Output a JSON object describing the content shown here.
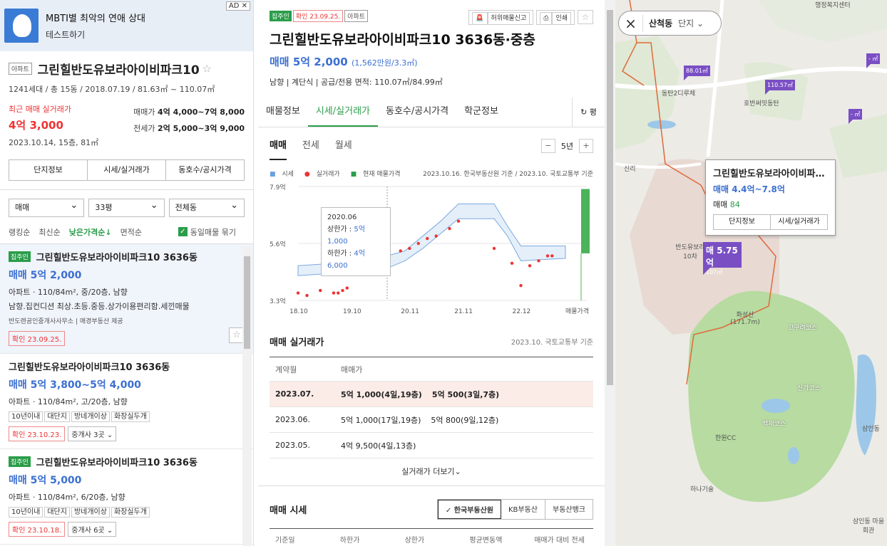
{
  "ad": {
    "title": "MBTI별 최악의 연애 상대",
    "subtitle": "테스트하기",
    "badge": "AD ✕"
  },
  "complex": {
    "type_tag": "아파트",
    "name": "그린힐반도유보라아이비파크10",
    "info": "1241세대 / 총 15동 / 2018.07.19 / 81.63㎡ ~ 110.07㎡",
    "recent_label": "최근 매매 실거래가",
    "recent_price": "4억 3,000",
    "recent_date": "2023.10.14, 15층, 81㎡",
    "sale_label": "매매가",
    "sale_range": "4억 4,000~7억 8,000",
    "jeonse_label": "전세가",
    "jeonse_range": "2억 5,000~3억 9,000",
    "buttons": [
      "단지정보",
      "시세/실거래가",
      "동호수/공시가격"
    ]
  },
  "filters": [
    "매매",
    "33평",
    "전체동"
  ],
  "sort": {
    "options": [
      "랭킹순",
      "최신순",
      "낮은가격순↓",
      "면적순"
    ],
    "active": 2,
    "group_label": "동일매물 묶기"
  },
  "listings": [
    {
      "tag": "집주인",
      "title": "그린힐반도유보라아이비파크10 3636동",
      "price": "매매 5억 2,000",
      "spec": "아파트 · 110/84m², 중/20층, 남향",
      "desc": "남향.집컨디션 최상.초등.중등.상가이용편리함.세낀매물",
      "agent": "반도렌공인중개사사무소 | 매경부동산 제공",
      "confirm": "확인 23.09.25."
    },
    {
      "tag": "",
      "title": "그린힐반도유보라아이비파크10 3636동",
      "price": "매매 5억 3,800~5억 4,000",
      "spec": "아파트 · 110/84m², 고/20층, 남향",
      "tags": [
        "10년이내",
        "대단지",
        "방네개이상",
        "화장실두개"
      ],
      "confirm": "확인 23.10.23.",
      "agents": "중개사 3곳 ⌄"
    },
    {
      "tag": "집주인",
      "title": "그린힐반도유보라아이비파크10 3636동",
      "price": "매매 5억 5,000",
      "spec": "아파트 · 110/84m², 6/20층, 남향",
      "tags": [
        "10년이내",
        "대단지",
        "방네개이상",
        "화장실두개"
      ],
      "confirm": "확인 23.10.18.",
      "agents": "중개사 6곳 ⌄"
    }
  ],
  "detail": {
    "tags": [
      "집주인",
      "확인 23.09.25.",
      "아파트"
    ],
    "tools": [
      "허위매물신고",
      "인쇄"
    ],
    "title": "그린힐반도유보라아이비파크10 3636동·중층",
    "price": "매매 5억 2,000",
    "price_unit": "(1,562만원/3.3㎡)",
    "meta": "남향 | 계단식 | 공급/전용 면적: 110.07㎡/84.99㎡",
    "tabs": [
      "매물정보",
      "시세/실거래가",
      "동호수/공시가격",
      "학군정보"
    ],
    "active_tab": 1,
    "pyeong": "평",
    "subtabs": [
      "매매",
      "전세",
      "월세"
    ],
    "period": "5년",
    "legend": [
      "시세",
      "실거래가",
      "현재 매물가격"
    ],
    "legend_source": "2023.10.16. 한국부동산원 기준 / 2023.10. 국토교통부 기준",
    "tooltip": {
      "date": "2020.06",
      "upper_label": "상한가 :",
      "upper": "5억1,000",
      "lower_label": "하한가 :",
      "lower": "4억6,000"
    },
    "deals_title": "매매 실거래가",
    "deals_source": "2023.10. 국토교통부 기준",
    "deals_header": [
      "계약월",
      "매매가"
    ],
    "deals": [
      {
        "month": "2023.07.",
        "items": [
          "5억 1,000(4일,19층)",
          "5억 500(3일,7층)"
        ]
      },
      {
        "month": "2023.06.",
        "items": [
          "5억 1,000(17일,19층)",
          "5억 800(9일,12층)"
        ]
      },
      {
        "month": "2023.05.",
        "items": [
          "4억 9,500(4일,13층)"
        ]
      }
    ],
    "more": "실거래가 더보기⌄",
    "market_title": "매매 시세",
    "market_sources": [
      "✓ 한국부동산원",
      "KB부동산",
      "부동산뱅크"
    ],
    "market_header": [
      "기준일",
      "하한가",
      "상한가",
      "평균변동액",
      "매매가 대비 전세"
    ]
  },
  "chart_data": {
    "type": "line",
    "x_ticks": [
      "18.10",
      "19.10",
      "20.11",
      "21.11",
      "22.12",
      "매물가격"
    ],
    "y_ticks": [
      "7.9억",
      "5.6억",
      "3.3억"
    ],
    "ylim": [
      3.3,
      7.9
    ],
    "band_upper": [
      [
        "2018.10",
        4.7
      ],
      [
        "2019.06",
        4.8
      ],
      [
        "2019.10",
        4.9
      ],
      [
        "2020.02",
        5.0
      ],
      [
        "2020.06",
        5.1
      ],
      [
        "2020.10",
        5.3
      ],
      [
        "2021.02",
        5.9
      ],
      [
        "2021.06",
        6.5
      ],
      [
        "2021.10",
        7.2
      ],
      [
        "2022.06",
        7.2
      ],
      [
        "2022.09",
        6.3
      ],
      [
        "2022.12",
        5.5
      ],
      [
        "2023.10",
        5.5
      ]
    ],
    "band_lower": [
      [
        "2018.10",
        4.3
      ],
      [
        "2019.06",
        4.4
      ],
      [
        "2019.10",
        4.5
      ],
      [
        "2020.02",
        4.6
      ],
      [
        "2020.06",
        4.6
      ],
      [
        "2020.10",
        4.9
      ],
      [
        "2021.02",
        5.4
      ],
      [
        "2021.06",
        6.0
      ],
      [
        "2021.10",
        6.6
      ],
      [
        "2022.06",
        6.6
      ],
      [
        "2022.09",
        5.9
      ],
      [
        "2022.12",
        4.9
      ],
      [
        "2023.10",
        5.0
      ]
    ],
    "deals": [
      [
        "2018.10",
        3.6
      ],
      [
        "2018.12",
        3.5
      ],
      [
        "2019.03",
        3.7
      ],
      [
        "2019.06",
        3.6
      ],
      [
        "2019.07",
        3.6
      ],
      [
        "2019.08",
        3.7
      ],
      [
        "2019.09",
        3.8
      ],
      [
        "2019.10",
        4.4
      ],
      [
        "2019.11",
        4.7
      ],
      [
        "2019.12",
        4.9
      ],
      [
        "2020.01",
        5.4
      ],
      [
        "2020.02",
        4.9
      ],
      [
        "2020.04",
        5.0
      ],
      [
        "2020.06",
        5.1
      ],
      [
        "2020.09",
        5.3
      ],
      [
        "2020.11",
        5.4
      ],
      [
        "2021.01",
        5.6
      ],
      [
        "2021.03",
        5.8
      ],
      [
        "2021.05",
        5.9
      ],
      [
        "2021.08",
        6.2
      ],
      [
        "2021.10",
        6.5
      ],
      [
        "2022.06",
        5.4
      ],
      [
        "2022.10",
        4.8
      ],
      [
        "2022.12",
        3.9
      ],
      [
        "2023.02",
        4.7
      ],
      [
        "2023.04",
        4.9
      ],
      [
        "2023.06",
        5.1
      ],
      [
        "2023.07",
        5.1
      ]
    ],
    "listing_range": [
      5.2,
      7.8
    ]
  },
  "map": {
    "search_dong": "산척동",
    "search_type": "단지",
    "popup": {
      "title": "그린힐반도유보라아이비파크10",
      "price": "매매 4.4억~7.8억",
      "count_label": "매매",
      "count": "84",
      "buttons": [
        "단지정보",
        "시세/실거래가"
      ]
    },
    "big_marker": {
      "value": "매 5.75억",
      "area": "107㎡"
    },
    "markers": [
      "88.01㎡",
      "110.57㎡",
      "- ㎡",
      "- ㎡"
    ],
    "labels": [
      "행정복지센터",
      "동탄2디루체",
      "호반써밋동탄",
      "신리",
      "반도유보라 10차",
      "화성산 (171.7m)",
      "고구려코스",
      "신라코스",
      "백제코스",
      "한원CC",
      "하나기술",
      "삼인동 마을회관",
      "삼인동"
    ]
  }
}
